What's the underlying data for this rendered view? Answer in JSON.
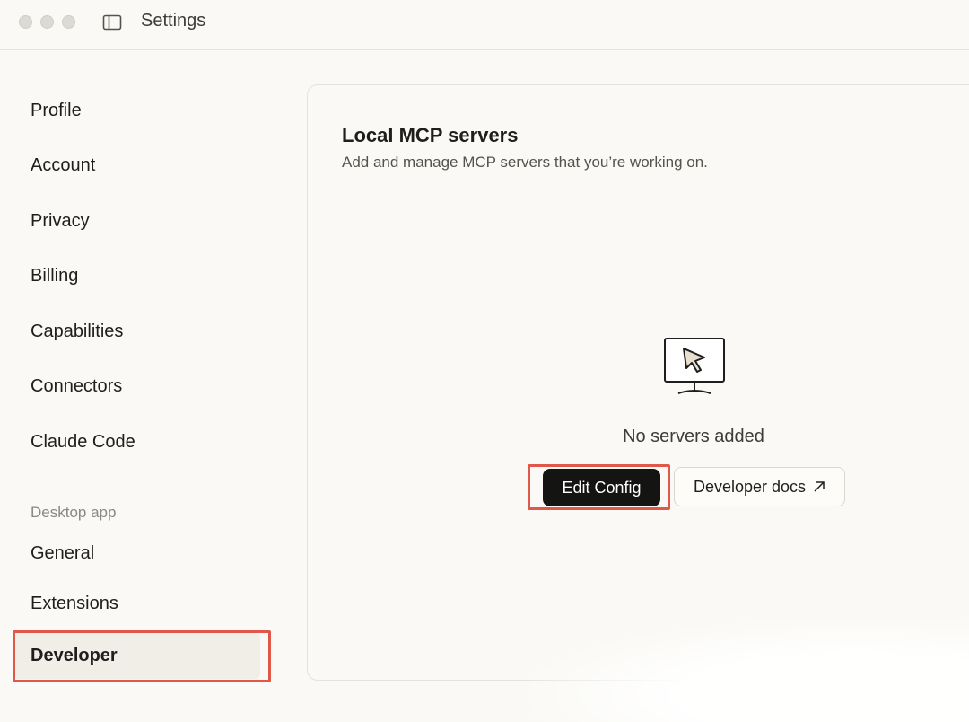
{
  "window": {
    "title": "Settings"
  },
  "sidebar": {
    "items": [
      {
        "label": "Profile"
      },
      {
        "label": "Account"
      },
      {
        "label": "Privacy"
      },
      {
        "label": "Billing"
      },
      {
        "label": "Capabilities"
      },
      {
        "label": "Connectors"
      },
      {
        "label": "Claude Code"
      }
    ],
    "section_label": "Desktop app",
    "desktop_items": [
      {
        "label": "General"
      },
      {
        "label": "Extensions"
      },
      {
        "label": "Developer",
        "active": true
      }
    ]
  },
  "main": {
    "title": "Local MCP servers",
    "subtitle": "Add and manage MCP servers that you’re working on.",
    "empty_state": "No servers added",
    "edit_config_label": "Edit Config",
    "developer_docs_label": "Developer docs"
  },
  "icons": {
    "sidebar_toggle": "sidebar-toggle-icon",
    "empty": "monitor-cursor-icon",
    "external": "arrow-up-right-icon"
  },
  "colors": {
    "accent_highlight": "#e0584a",
    "primary_button": "#141413",
    "background": "#faf9f5"
  }
}
